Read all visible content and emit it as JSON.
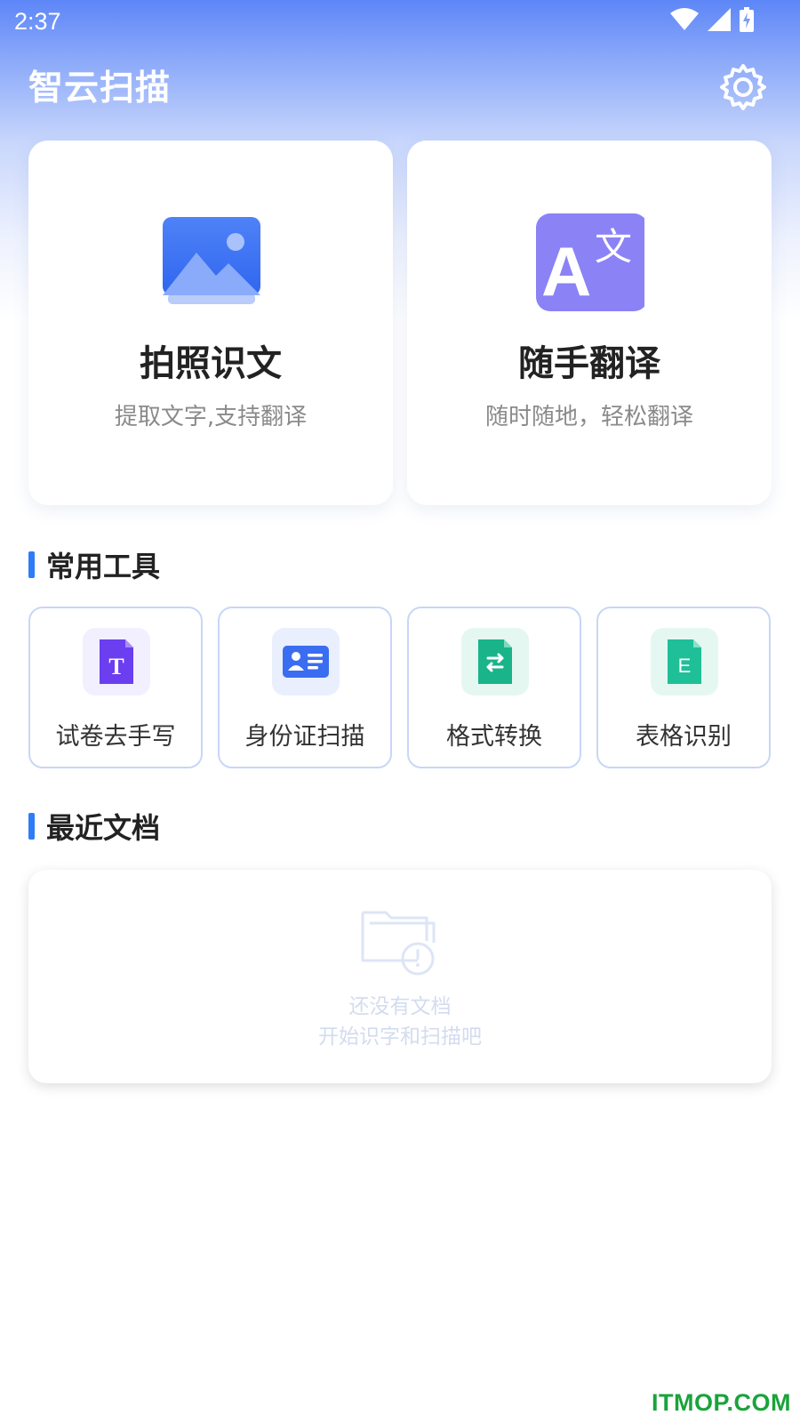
{
  "status_bar": {
    "time": "2:37"
  },
  "header": {
    "app_title": "智云扫描",
    "settings_icon": "gear-icon"
  },
  "feature_cards": [
    {
      "icon": "photo-image-icon",
      "title": "拍照识文",
      "subtitle": "提取文字,支持翻译"
    },
    {
      "icon": "translate-icon",
      "title": "随手翻译",
      "subtitle": "随时随地，轻松翻译",
      "icon_glyph_a": "A",
      "icon_glyph_b": "文"
    }
  ],
  "tools_section": {
    "title": "常用工具",
    "items": [
      {
        "label": "试卷去手写",
        "icon": "text-document-icon",
        "glyph": "T"
      },
      {
        "label": "身份证扫描",
        "icon": "id-card-icon"
      },
      {
        "label": "格式转换",
        "icon": "format-convert-icon"
      },
      {
        "label": "表格识别",
        "icon": "excel-document-icon",
        "glyph": "E"
      }
    ]
  },
  "recent_section": {
    "title": "最近文档",
    "empty_icon": "empty-folder-icon",
    "empty_line1": "还没有文档",
    "empty_line2": "开始识字和扫描吧"
  },
  "watermark": "ITMOP.COM",
  "colors": {
    "accent": "#2f7cf6",
    "translate_bg": "#8b82f6",
    "text_doc": "#6b3ef0",
    "id_card": "#3a6df0",
    "convert": "#19b48a",
    "excel": "#1fbf98"
  }
}
